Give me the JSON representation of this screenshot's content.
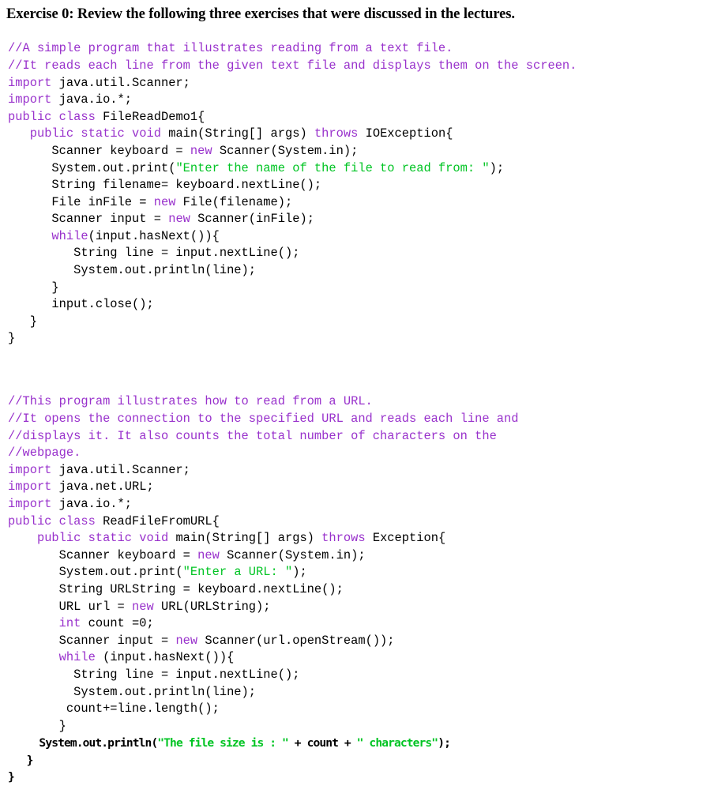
{
  "document": {
    "heading": "Exercise 0: Review the following three exercises that were discussed in the lectures.",
    "colors": {
      "keyword": "#9932CC",
      "comment": "#9932CC",
      "string": "#00C423",
      "identifier": "#000000",
      "background": "#ffffff"
    },
    "listings": [
      {
        "name": "FileReadDemo1",
        "lines": [
          [
            {
              "t": "//A simple program that illustrates reading from a text file.",
              "c": "cm"
            }
          ],
          [
            {
              "t": "//It reads each line from the given text file and displays them on the screen.",
              "c": "cm"
            }
          ],
          [
            {
              "t": "import",
              "c": "kw"
            },
            {
              "t": " java.util.Scanner;",
              "c": "id"
            }
          ],
          [
            {
              "t": "import",
              "c": "kw"
            },
            {
              "t": " java.io.*;",
              "c": "id"
            }
          ],
          [
            {
              "t": "public class",
              "c": "kw"
            },
            {
              "t": " FileReadDemo1{",
              "c": "id"
            }
          ],
          [
            {
              "t": "   ",
              "c": "id"
            },
            {
              "t": "public static void",
              "c": "kw"
            },
            {
              "t": " main(String[] args) ",
              "c": "id"
            },
            {
              "t": "throws",
              "c": "kw"
            },
            {
              "t": " IOException{",
              "c": "id"
            }
          ],
          [
            {
              "t": "      Scanner keyboard = ",
              "c": "id"
            },
            {
              "t": "new",
              "c": "kw"
            },
            {
              "t": " Scanner(System.in);",
              "c": "id"
            }
          ],
          [
            {
              "t": "      System.out.print(",
              "c": "id"
            },
            {
              "t": "\"Enter the name of the file to read from: \"",
              "c": "str"
            },
            {
              "t": ");",
              "c": "id"
            }
          ],
          [
            {
              "t": "      String filename= keyboard.nextLine();",
              "c": "id"
            }
          ],
          [
            {
              "t": "      File inFile = ",
              "c": "id"
            },
            {
              "t": "new",
              "c": "kw"
            },
            {
              "t": " File(filename);",
              "c": "id"
            }
          ],
          [
            {
              "t": "      Scanner input = ",
              "c": "id"
            },
            {
              "t": "new",
              "c": "kw"
            },
            {
              "t": " Scanner(inFile);",
              "c": "id"
            }
          ],
          [
            {
              "t": "      ",
              "c": "id"
            },
            {
              "t": "while",
              "c": "kw"
            },
            {
              "t": "(input.hasNext()){",
              "c": "id"
            }
          ],
          [
            {
              "t": "         String line = input.nextLine();",
              "c": "id"
            }
          ],
          [
            {
              "t": "         System.out.println(line);",
              "c": "id"
            }
          ],
          [
            {
              "t": "      }",
              "c": "id"
            }
          ],
          [
            {
              "t": "      input.close();",
              "c": "id"
            }
          ],
          [
            {
              "t": "   }",
              "c": "id"
            }
          ],
          [
            {
              "t": "}",
              "c": "id"
            }
          ]
        ]
      },
      {
        "name": "ReadFileFromURL",
        "lines": [
          [
            {
              "t": "//This program illustrates how to read from a URL.",
              "c": "cm"
            }
          ],
          [
            {
              "t": "//It opens the connection to the specified URL and reads each line and",
              "c": "cm"
            }
          ],
          [
            {
              "t": "//displays it. It also counts the total number of characters on the",
              "c": "cm"
            }
          ],
          [
            {
              "t": "//webpage.",
              "c": "cm"
            }
          ],
          [
            {
              "t": "import",
              "c": "kw"
            },
            {
              "t": " java.util.Scanner;",
              "c": "id"
            }
          ],
          [
            {
              "t": "import",
              "c": "kw"
            },
            {
              "t": " java.net.URL;",
              "c": "id"
            }
          ],
          [
            {
              "t": "import",
              "c": "kw"
            },
            {
              "t": " java.io.*;",
              "c": "id"
            }
          ],
          [
            {
              "t": "public class",
              "c": "kw"
            },
            {
              "t": " ReadFileFromURL{",
              "c": "id"
            }
          ],
          [
            {
              "t": "    ",
              "c": "id"
            },
            {
              "t": "public static void",
              "c": "kw"
            },
            {
              "t": " main(String[] args) ",
              "c": "id"
            },
            {
              "t": "throws",
              "c": "kw"
            },
            {
              "t": " Exception{",
              "c": "id"
            }
          ],
          [
            {
              "t": "       Scanner keyboard = ",
              "c": "id"
            },
            {
              "t": "new",
              "c": "kw"
            },
            {
              "t": " Scanner(System.in);",
              "c": "id"
            }
          ],
          [
            {
              "t": "       System.out.print(",
              "c": "id"
            },
            {
              "t": "\"Enter a URL: \"",
              "c": "str"
            },
            {
              "t": ");",
              "c": "id"
            }
          ],
          [
            {
              "t": "       String URLString = keyboard.nextLine();",
              "c": "id"
            }
          ],
          [
            {
              "t": "       URL url = ",
              "c": "id"
            },
            {
              "t": "new",
              "c": "kw"
            },
            {
              "t": " URL(URLString);",
              "c": "id"
            }
          ],
          [
            {
              "t": "       ",
              "c": "id"
            },
            {
              "t": "int",
              "c": "kw"
            },
            {
              "t": " count =0;",
              "c": "id"
            }
          ],
          [
            {
              "t": "       Scanner input = ",
              "c": "id"
            },
            {
              "t": "new",
              "c": "kw"
            },
            {
              "t": " Scanner(url.openStream());",
              "c": "id"
            }
          ],
          [
            {
              "t": "       ",
              "c": "id"
            },
            {
              "t": "while",
              "c": "kw"
            },
            {
              "t": " (input.hasNext()){",
              "c": "id"
            }
          ],
          [
            {
              "t": "         String line = input.nextLine();",
              "c": "id"
            }
          ],
          [
            {
              "t": "         System.out.println(line);",
              "c": "id"
            }
          ],
          [
            {
              "t": "        count+=line.length();",
              "c": "id"
            }
          ],
          [
            {
              "t": "       }",
              "c": "id"
            }
          ]
        ],
        "final_lines": [
          [
            {
              "t": "     System.out.println(",
              "c": "id"
            },
            {
              "t": "\"The file size is : \"",
              "c": "str"
            },
            {
              "t": " + count + ",
              "c": "id"
            },
            {
              "t": "\" characters\"",
              "c": "str"
            },
            {
              "t": ");",
              "c": "id"
            }
          ],
          [
            {
              "t": "   }",
              "c": "id"
            }
          ],
          [
            {
              "t": "}",
              "c": "id"
            }
          ]
        ]
      }
    ]
  }
}
